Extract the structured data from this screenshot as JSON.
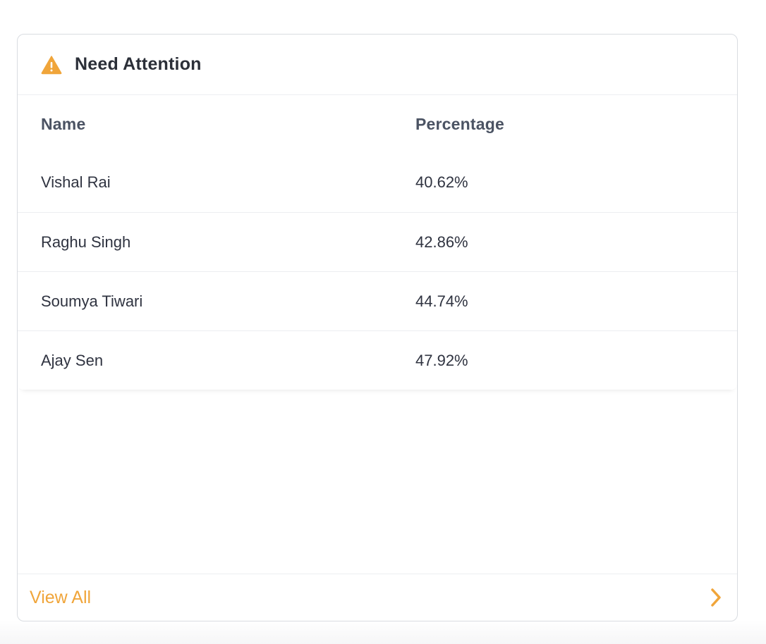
{
  "card": {
    "title": "Need Attention",
    "icon": "warning-icon",
    "accent_color": "#f0a53a"
  },
  "table": {
    "columns": [
      "Name",
      "Percentage"
    ],
    "rows": [
      {
        "name": "Vishal Rai",
        "percentage": "40.62%"
      },
      {
        "name": "Raghu Singh",
        "percentage": "42.86%"
      },
      {
        "name": "Soumya Tiwari",
        "percentage": "44.74%"
      },
      {
        "name": "Ajay Sen",
        "percentage": "47.92%"
      }
    ]
  },
  "footer": {
    "link_label": "View All",
    "icon": "chevron-right-icon"
  }
}
